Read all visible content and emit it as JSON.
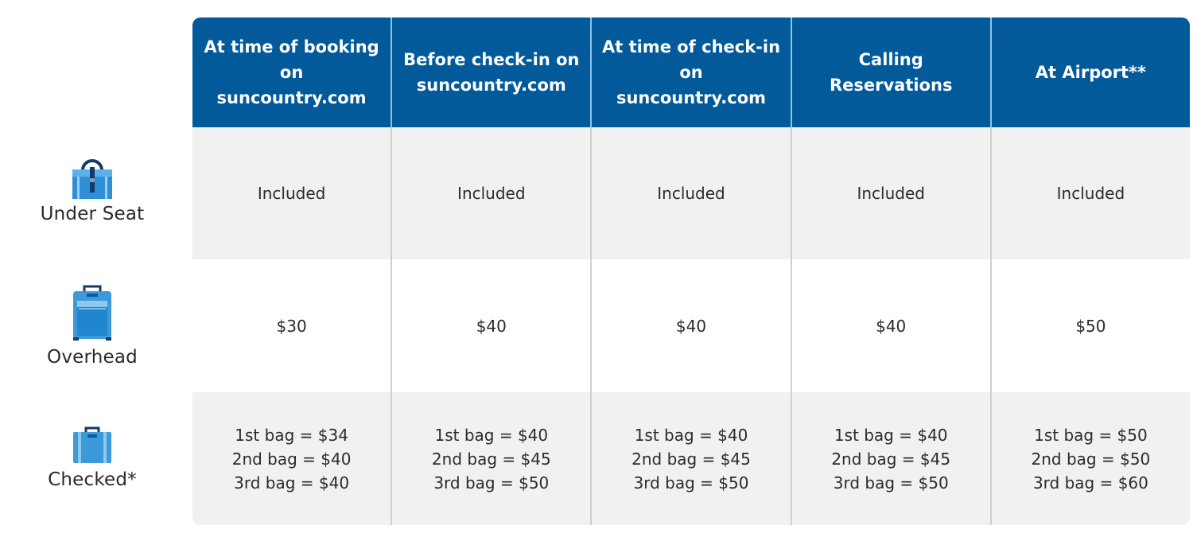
{
  "columns": [
    {
      "label": "At time of booking on suncountry.com",
      "lines": [
        "At time of booking",
        "on",
        "suncountry.com"
      ]
    },
    {
      "label": "Before check-in on suncountry.com",
      "lines": [
        "Before check-in on",
        "suncountry.com"
      ]
    },
    {
      "label": "At time of check-in on suncountry.com",
      "lines": [
        "At time of check-in",
        "on",
        "suncountry.com"
      ]
    },
    {
      "label": "Calling Reservations",
      "lines": [
        "Calling",
        "Reservations"
      ]
    },
    {
      "label": "At Airport**",
      "lines": [
        "At Airport**"
      ]
    }
  ],
  "rows": [
    {
      "label": "Under Seat",
      "icon": "personal-item-bag-icon",
      "cells": [
        [
          "Included"
        ],
        [
          "Included"
        ],
        [
          "Included"
        ],
        [
          "Included"
        ],
        [
          "Included"
        ]
      ]
    },
    {
      "label": "Overhead",
      "icon": "carry-on-suitcase-icon",
      "cells": [
        [
          "$30"
        ],
        [
          "$40"
        ],
        [
          "$40"
        ],
        [
          "$40"
        ],
        [
          "$50"
        ]
      ]
    },
    {
      "label": "Checked*",
      "icon": "checked-suitcase-icon",
      "cells": [
        [
          "1st bag = $34",
          "2nd bag = $40",
          "3rd bag = $40"
        ],
        [
          "1st bag = $40",
          "2nd bag = $45",
          "3rd bag = $50"
        ],
        [
          "1st bag = $40",
          "2nd bag = $45",
          "3rd bag = $50"
        ],
        [
          "1st bag = $40",
          "2nd bag = $45",
          "3rd bag = $50"
        ],
        [
          "1st bag = $50",
          "2nd bag = $50",
          "3rd bag = $60"
        ]
      ]
    }
  ],
  "colors": {
    "header_bg": "#025a9a",
    "header_divider": "#8ec2ea",
    "row_alt_bg": "#f1f1f1",
    "icon_blue": "#3d9ad9",
    "icon_dark": "#0d3b6e"
  }
}
